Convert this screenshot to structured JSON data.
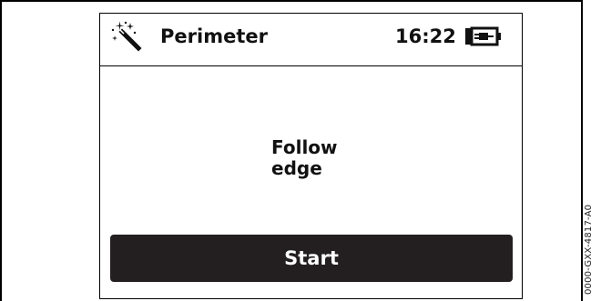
{
  "header": {
    "title": "Perimeter",
    "time": "16:22",
    "left_icon": "magic-wand-icon",
    "right_icon": "battery-charging-icon"
  },
  "main": {
    "message_line1": "Follow",
    "message_line2": "edge"
  },
  "actions": {
    "start_label": "Start"
  },
  "figure": {
    "reference_code": "0000-GXX-4817-A0"
  },
  "colors": {
    "button_bg": "#231f20",
    "button_text": "#ffffff",
    "border": "#000000"
  }
}
